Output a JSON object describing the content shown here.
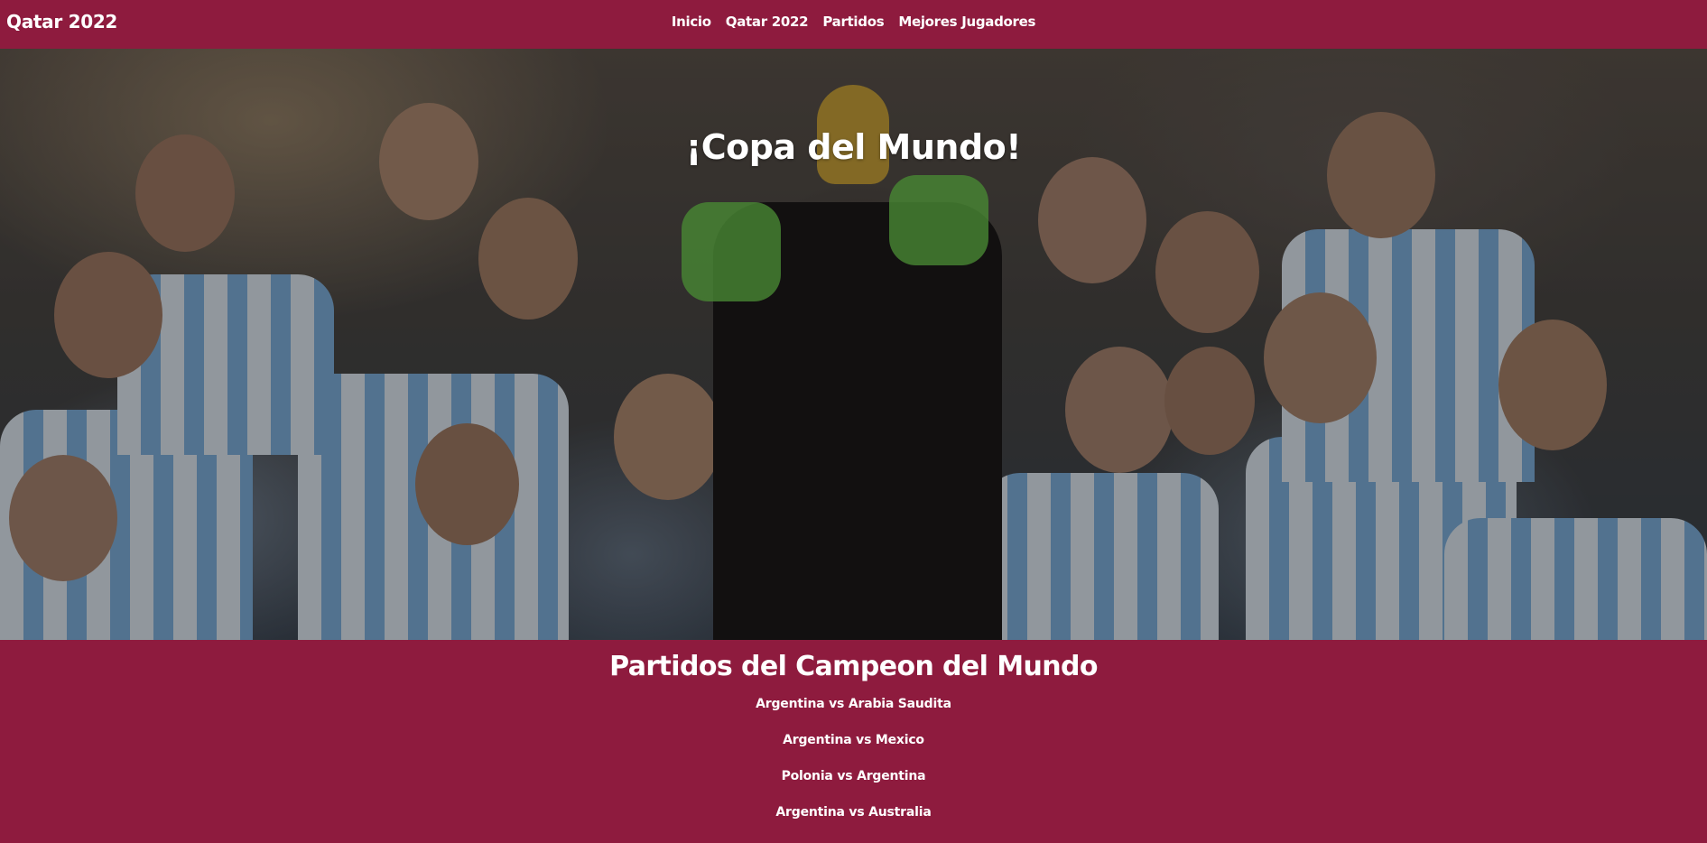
{
  "navbar": {
    "brand": "Qatar 2022",
    "links": [
      "Inicio",
      "Qatar 2022",
      "Partidos",
      "Mejores Jugadores"
    ]
  },
  "hero": {
    "title": "¡Copa del Mundo!",
    "image_description_icon": "celebration-photo"
  },
  "matches_section": {
    "title": "Partidos del Campeon del Mundo",
    "matches": [
      "Argentina vs Arabia Saudita",
      "Argentina vs Mexico",
      "Polonia vs Argentina",
      "Argentina vs Australia"
    ]
  },
  "colors": {
    "brand": "#8e1b3e",
    "text": "#ffffff"
  }
}
